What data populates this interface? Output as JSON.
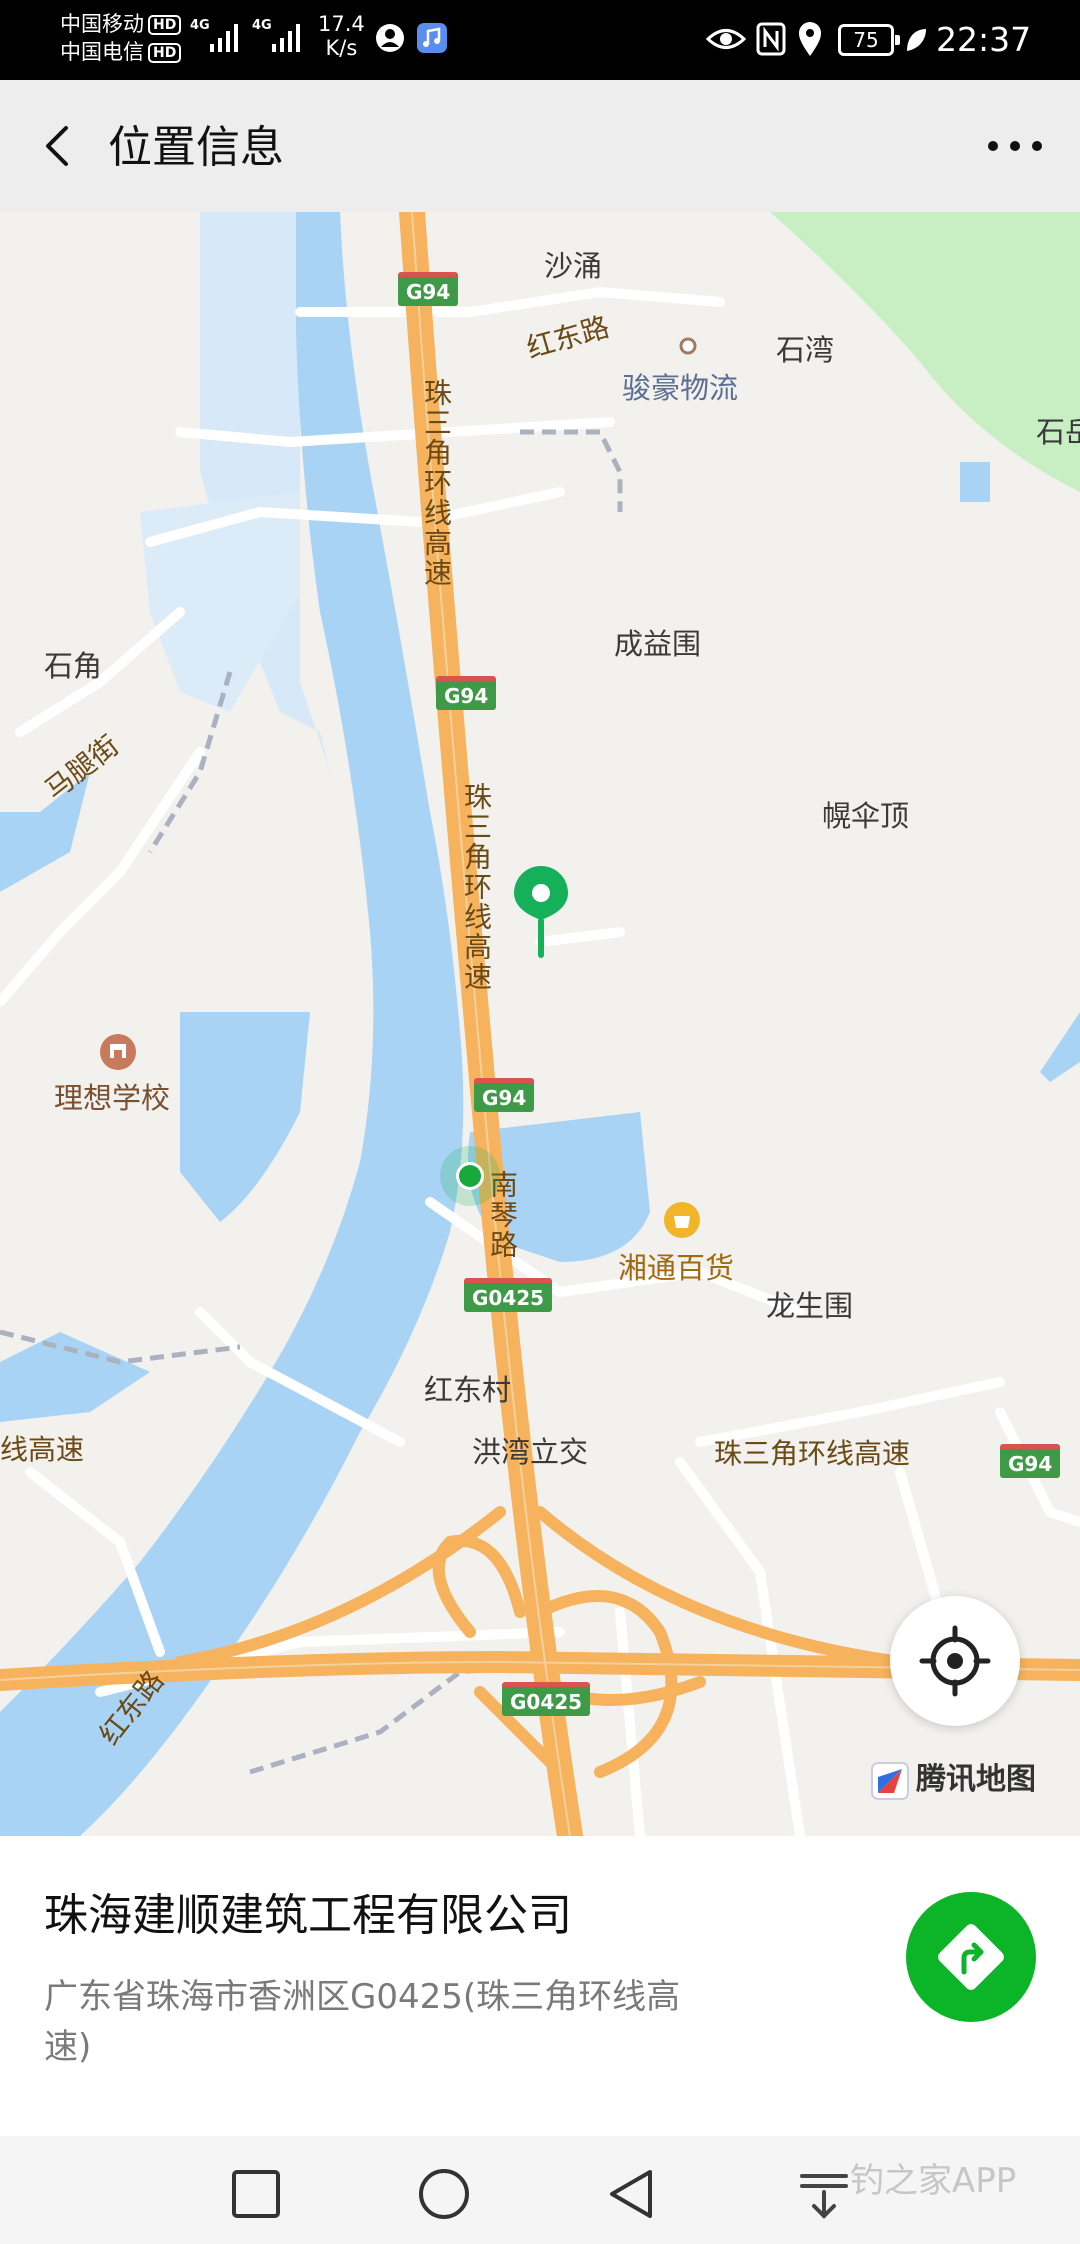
{
  "status_bar": {
    "carrier1": "中国移动",
    "carrier2": "中国电信",
    "hd_badge": "HD",
    "network1": "4G",
    "network2": "4G",
    "speed_value": "17.4",
    "speed_unit": "K/s",
    "battery": "75",
    "time": "22:37"
  },
  "header": {
    "title": "位置信息"
  },
  "map": {
    "labels": {
      "shachong": "沙涌",
      "hongdong_road_top": "红东路",
      "junhao": "骏豪物流",
      "shiwan": "石湾",
      "shi_edge": "石岳",
      "chengyiwei": "成益围",
      "shijiao": "石角",
      "matuijie": "马腿街",
      "huangsanding": "幌伞顶",
      "lixiang_school": "理想学校",
      "nanqin_road": "南琴路",
      "xiangtong": "湘通百货",
      "longshengwei": "龙生围",
      "hongdongcun": "红东村",
      "hongwan_interchange": "洪湾立交",
      "prd_ring_upper": "珠三角环线高速",
      "prd_ring_middle": "珠三角环线高速",
      "prd_ring_east": "珠三角环线高速",
      "ring_west_fragment": "线高速",
      "hongdong_road_bottom": "红东路"
    },
    "shields": {
      "g94_top": "G94",
      "g94_mid": "G94",
      "g94_low": "G94",
      "g94_east": "G94",
      "g0425_upper": "G0425",
      "g0425_lower": "G0425"
    },
    "provider_logo": "腾讯地图"
  },
  "place": {
    "name": "珠海建顺建筑工程有限公司",
    "address": "广东省珠海市香洲区G0425(珠三角环线高速)"
  },
  "nav_bar": {
    "watermark": "钓之家APP"
  },
  "colors": {
    "accent_green": "#0cb528",
    "water_blue": "#a9d3f5",
    "highway_orange": "#f6b25c",
    "park_green": "#c8efc4"
  }
}
